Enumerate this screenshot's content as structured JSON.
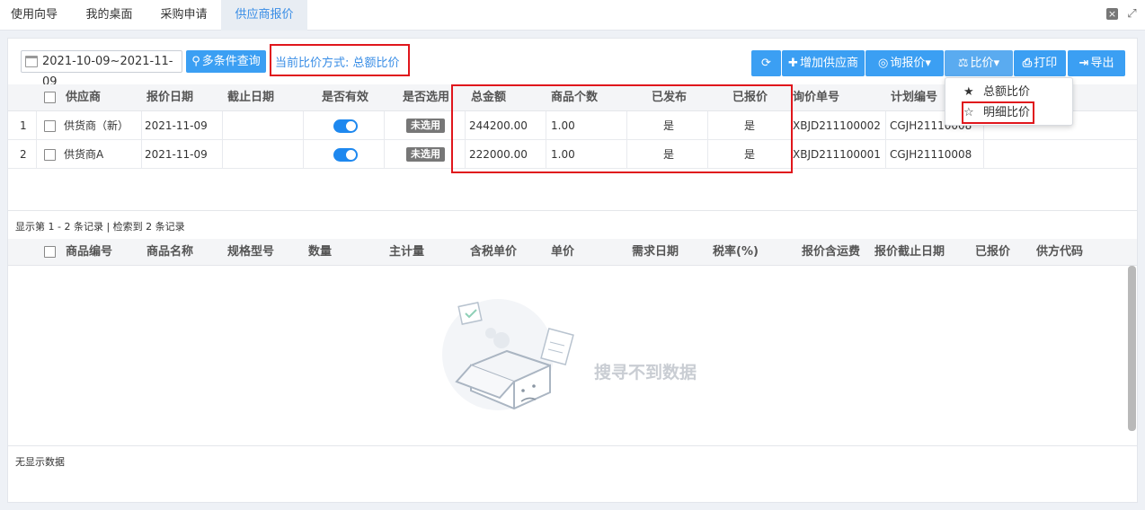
{
  "tabs": [
    {
      "label": "使用向导"
    },
    {
      "label": "我的桌面"
    },
    {
      "label": "采购申请"
    },
    {
      "label": "供应商报价"
    }
  ],
  "toolbar": {
    "date_range": "2021-10-09~2021-11-09",
    "search_label": "多条件查询",
    "mode_text": "当前比价方式: 总额比价",
    "add_supplier": "增加供应商",
    "inquiry": "询报价",
    "compare": "比价",
    "print": "打印",
    "export": "导出"
  },
  "compare_menu": [
    {
      "label": "总额比价",
      "icon": "star-filled-icon"
    },
    {
      "label": "明细比价",
      "icon": "star-outline-icon"
    }
  ],
  "top_table": {
    "headers": [
      "供应商",
      "报价日期",
      "截止日期",
      "是否有效",
      "是否选用",
      "总金额",
      "商品个数",
      "已发布",
      "已报价",
      "询价单号",
      "计划编号"
    ],
    "rows": [
      {
        "no": "1",
        "supplier": "供货商（新）",
        "quote_date": "2021-11-09",
        "deadline": "",
        "valid": true,
        "selected": "未选用",
        "total": "244200.00",
        "count": "1.00",
        "published": "是",
        "quoted": "是",
        "inquiry_no": "XBJD211100002",
        "plan_no": "CGJH21110008"
      },
      {
        "no": "2",
        "supplier": "供货商A",
        "quote_date": "2021-11-09",
        "deadline": "",
        "valid": true,
        "selected": "未选用",
        "total": "222000.00",
        "count": "1.00",
        "published": "是",
        "quoted": "是",
        "inquiry_no": "XBJD211100001",
        "plan_no": "CGJH21110008"
      }
    ],
    "footer": "显示第 1 - 2 条记录 | 检索到 2 条记录"
  },
  "bottom_table": {
    "headers": [
      "商品编号",
      "商品名称",
      "规格型号",
      "数量",
      "主计量",
      "含税单价",
      "单价",
      "需求日期",
      "税率(%)",
      "报价含运费",
      "报价截止日期",
      "已报价",
      "供方代码"
    ],
    "empty_text": "搜寻不到数据",
    "footer": "无显示数据"
  },
  "colors": {
    "accent": "#3b9ff3",
    "highlight": "#e0161c",
    "toggle": "#1e88ef"
  }
}
